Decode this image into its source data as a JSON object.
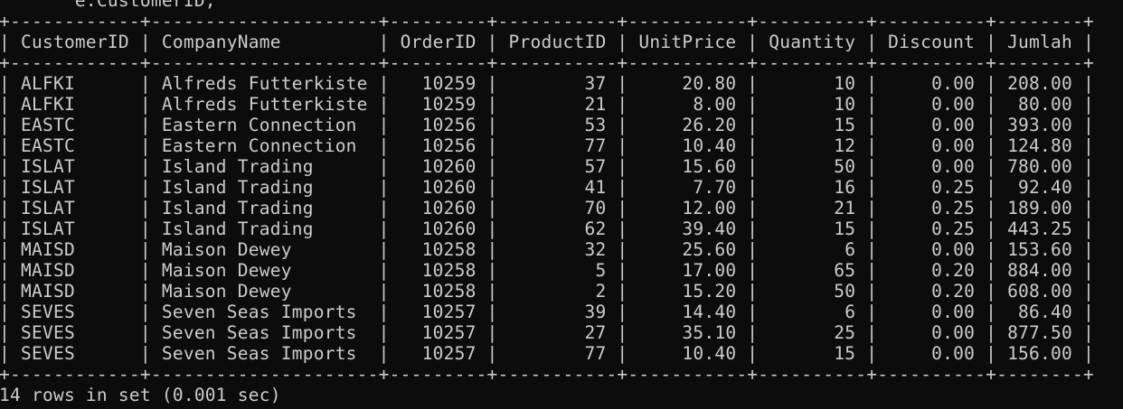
{
  "terminal": {
    "colors": {
      "background": "#0c0c0c",
      "foreground": "#cccccc"
    },
    "prev_command_fragment": "e.CustomerID;",
    "table": {
      "columns": [
        {
          "label": "CustomerID",
          "align": "left"
        },
        {
          "label": "CompanyName",
          "align": "left"
        },
        {
          "label": "OrderID",
          "align": "right"
        },
        {
          "label": "ProductID",
          "align": "right"
        },
        {
          "label": "UnitPrice",
          "align": "right"
        },
        {
          "label": "Quantity",
          "align": "right"
        },
        {
          "label": "Discount",
          "align": "right"
        },
        {
          "label": "Jumlah",
          "align": "right"
        }
      ],
      "rows": [
        [
          "ALFKI",
          "Alfreds Futterkiste",
          "10259",
          "37",
          "20.80",
          "10",
          "0.00",
          "208.00"
        ],
        [
          "ALFKI",
          "Alfreds Futterkiste",
          "10259",
          "21",
          "8.00",
          "10",
          "0.00",
          "80.00"
        ],
        [
          "EASTC",
          "Eastern Connection",
          "10256",
          "53",
          "26.20",
          "15",
          "0.00",
          "393.00"
        ],
        [
          "EASTC",
          "Eastern Connection",
          "10256",
          "77",
          "10.40",
          "12",
          "0.00",
          "124.80"
        ],
        [
          "ISLAT",
          "Island Trading",
          "10260",
          "57",
          "15.60",
          "50",
          "0.00",
          "780.00"
        ],
        [
          "ISLAT",
          "Island Trading",
          "10260",
          "41",
          "7.70",
          "16",
          "0.25",
          "92.40"
        ],
        [
          "ISLAT",
          "Island Trading",
          "10260",
          "70",
          "12.00",
          "21",
          "0.25",
          "189.00"
        ],
        [
          "ISLAT",
          "Island Trading",
          "10260",
          "62",
          "39.40",
          "15",
          "0.25",
          "443.25"
        ],
        [
          "MAISD",
          "Maison Dewey",
          "10258",
          "32",
          "25.60",
          "6",
          "0.00",
          "153.60"
        ],
        [
          "MAISD",
          "Maison Dewey",
          "10258",
          "5",
          "17.00",
          "65",
          "0.20",
          "884.00"
        ],
        [
          "MAISD",
          "Maison Dewey",
          "10258",
          "2",
          "15.20",
          "50",
          "0.20",
          "608.00"
        ],
        [
          "SEVES",
          "Seven Seas Imports",
          "10257",
          "39",
          "14.40",
          "6",
          "0.00",
          "86.40"
        ],
        [
          "SEVES",
          "Seven Seas Imports",
          "10257",
          "27",
          "35.10",
          "25",
          "0.00",
          "877.50"
        ],
        [
          "SEVES",
          "Seven Seas Imports",
          "10257",
          "77",
          "10.40",
          "15",
          "0.00",
          "156.00"
        ]
      ]
    },
    "status": "14 rows in set (0.001 sec)"
  }
}
